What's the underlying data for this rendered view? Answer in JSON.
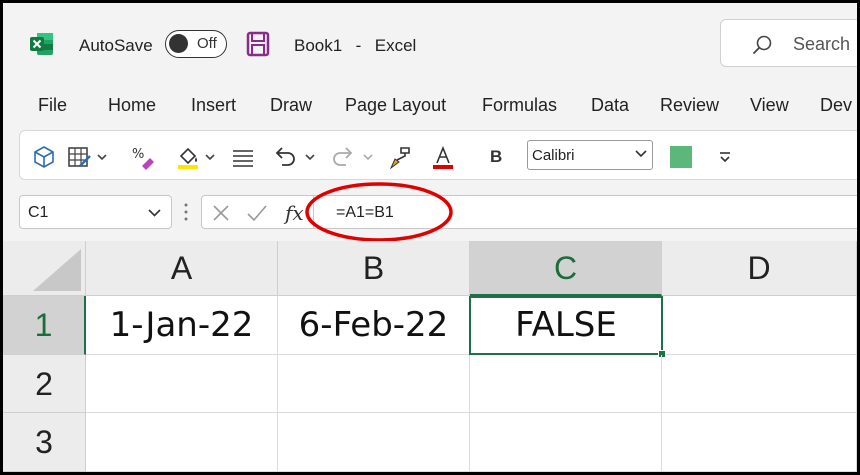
{
  "titlebar": {
    "autosave_label": "AutoSave",
    "autosave_state": "Off",
    "document_title": "Book1  -  Excel",
    "search_placeholder": "Search"
  },
  "menu": [
    {
      "label": "File"
    },
    {
      "label": "Home"
    },
    {
      "label": "Insert"
    },
    {
      "label": "Draw"
    },
    {
      "label": "Page Layout"
    },
    {
      "label": "Formulas"
    },
    {
      "label": "Data"
    },
    {
      "label": "Review"
    },
    {
      "label": "View"
    },
    {
      "label": "Dev"
    }
  ],
  "ribbon": {
    "bold_label": "B",
    "font_name": "Calibri",
    "font_color": "#e00000",
    "highlight_color": "#ffe600",
    "fill_color": "#5cb87a"
  },
  "formula_bar": {
    "name_box": "C1",
    "fx_label": "fx",
    "formula": "=A1=B1",
    "annotation_color": "#e10000"
  },
  "sheet": {
    "columns": [
      "A",
      "B",
      "C",
      "D"
    ],
    "rows": [
      "1",
      "2",
      "3"
    ],
    "cells": {
      "A1": "1-Jan-22",
      "B1": "6-Feb-22",
      "C1": "FALSE"
    },
    "selected_cell": "C1",
    "accent_color": "#1e7145"
  }
}
